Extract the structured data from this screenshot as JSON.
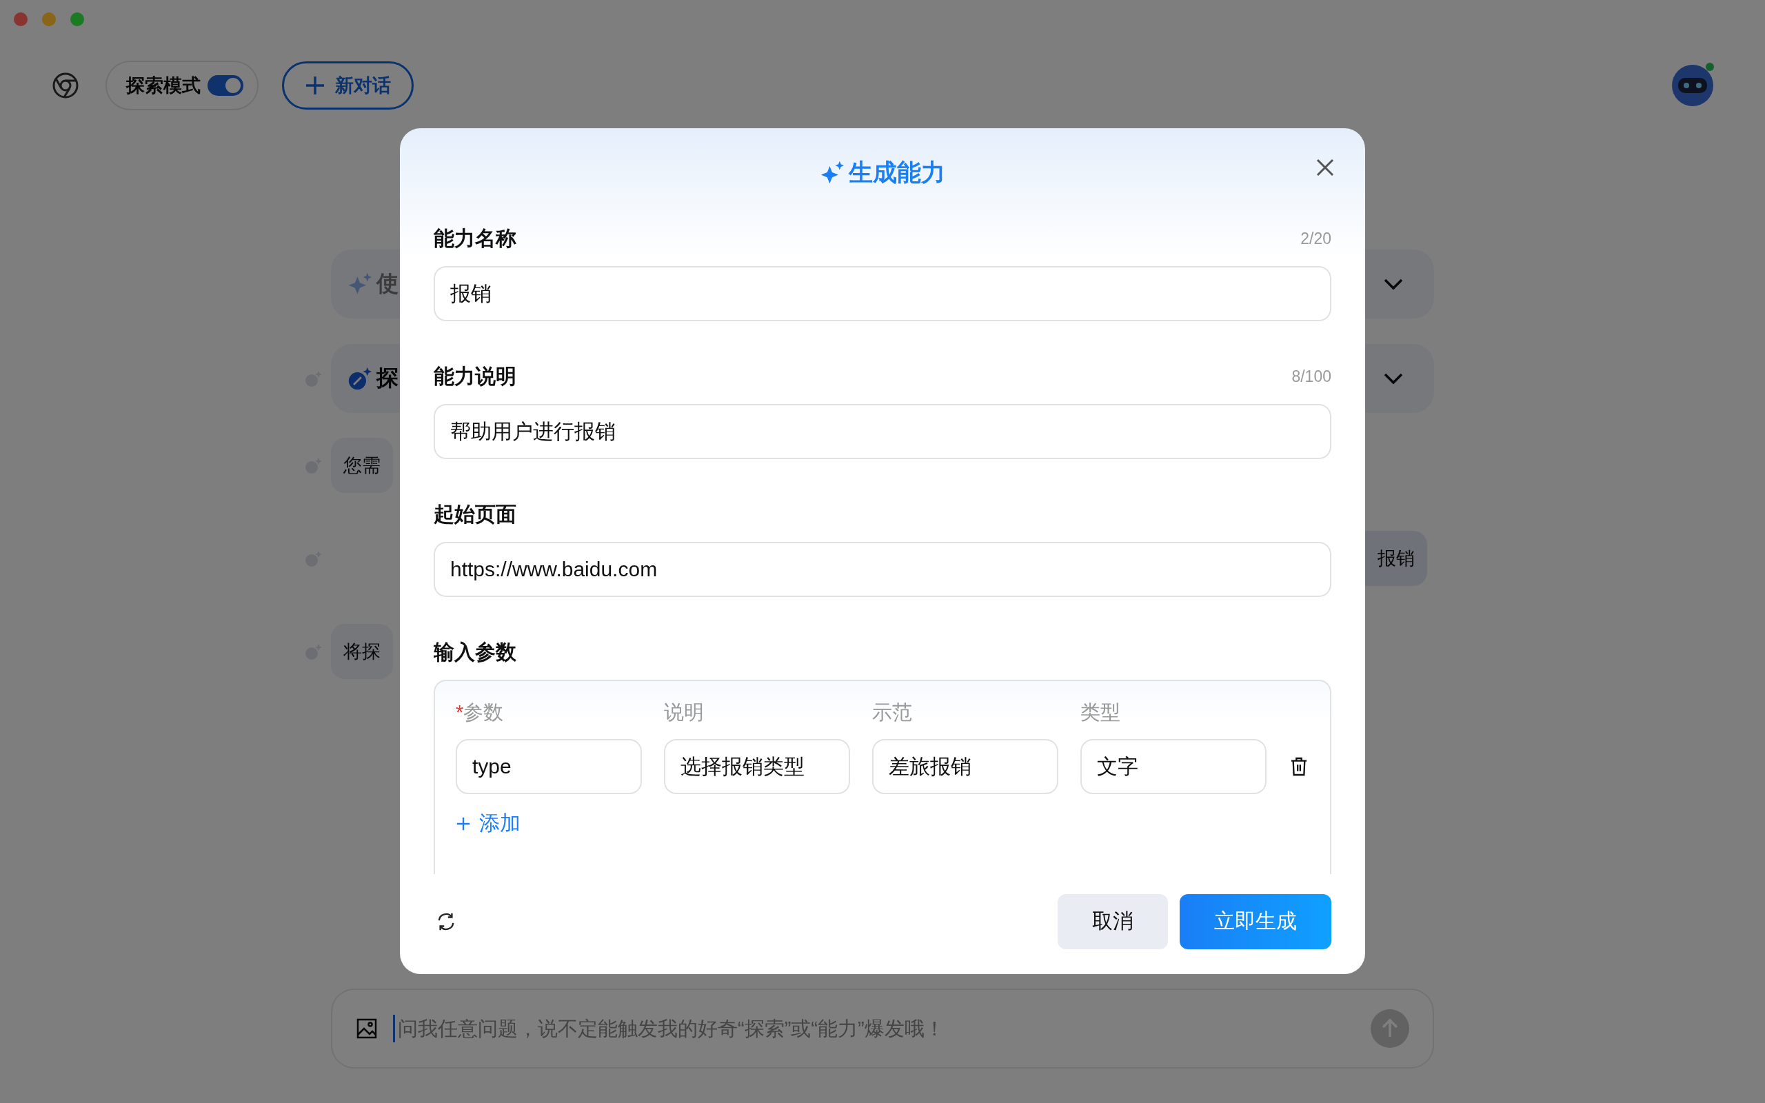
{
  "window": {
    "controls": [
      {
        "color": "#893430"
      },
      {
        "color": "#8a6517"
      },
      {
        "color": "#1b7a23"
      }
    ]
  },
  "toolbar": {
    "explore_mode": {
      "label": "探索模式",
      "on": true
    },
    "new_chat_button": {
      "label": "新对话"
    }
  },
  "background": {
    "cards": [
      {
        "kind": "sparkle",
        "text": "使"
      },
      {
        "kind": "explore",
        "text": "探"
      }
    ],
    "messages": [
      {
        "text": "您需",
        "kind": "received"
      },
      {
        "text": "报销",
        "kind": "sent"
      },
      {
        "text": "将探",
        "kind": "received"
      }
    ],
    "input": {
      "placeholder": "问我任意问题，说不定能触发我的好奇“探索”或“能力”爆发哦！"
    }
  },
  "dialog": {
    "title": "生成能力",
    "fields": [
      {
        "label": "能力名称",
        "count": "2/20",
        "value": "报销"
      },
      {
        "label": "能力说明",
        "count": "8/100",
        "value": "帮助用户进行报销"
      },
      {
        "label": "起始页面",
        "value": "https://www.baidu.com"
      }
    ],
    "params": {
      "label": "输入参数",
      "columns": [
        {
          "label": "参数",
          "marker": "*"
        },
        {
          "label": "说明"
        },
        {
          "label": "示范"
        },
        {
          "label": "类型"
        }
      ],
      "rows": [
        [
          "type",
          "选择报销类型",
          "差旅报销",
          "文字"
        ]
      ],
      "add_label": "添加"
    },
    "buttons": {
      "cancel": "取消",
      "generate": "立即生成"
    }
  }
}
